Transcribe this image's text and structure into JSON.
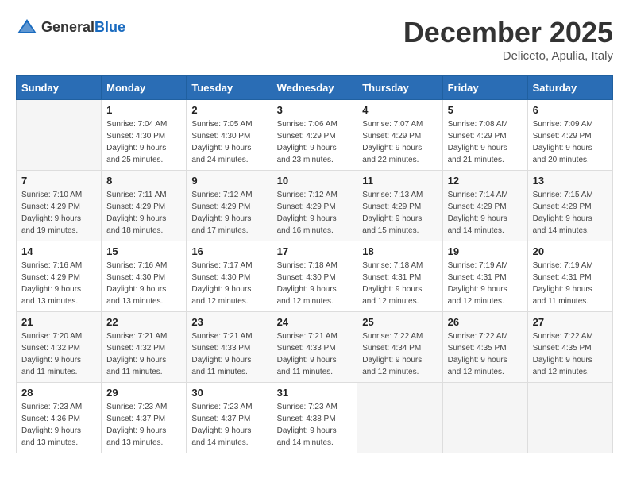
{
  "header": {
    "logo_general": "General",
    "logo_blue": "Blue",
    "month_title": "December 2025",
    "location": "Deliceto, Apulia, Italy"
  },
  "weekdays": [
    "Sunday",
    "Monday",
    "Tuesday",
    "Wednesday",
    "Thursday",
    "Friday",
    "Saturday"
  ],
  "weeks": [
    [
      {
        "day": "",
        "info": ""
      },
      {
        "day": "1",
        "info": "Sunrise: 7:04 AM\nSunset: 4:30 PM\nDaylight: 9 hours\nand 25 minutes."
      },
      {
        "day": "2",
        "info": "Sunrise: 7:05 AM\nSunset: 4:30 PM\nDaylight: 9 hours\nand 24 minutes."
      },
      {
        "day": "3",
        "info": "Sunrise: 7:06 AM\nSunset: 4:29 PM\nDaylight: 9 hours\nand 23 minutes."
      },
      {
        "day": "4",
        "info": "Sunrise: 7:07 AM\nSunset: 4:29 PM\nDaylight: 9 hours\nand 22 minutes."
      },
      {
        "day": "5",
        "info": "Sunrise: 7:08 AM\nSunset: 4:29 PM\nDaylight: 9 hours\nand 21 minutes."
      },
      {
        "day": "6",
        "info": "Sunrise: 7:09 AM\nSunset: 4:29 PM\nDaylight: 9 hours\nand 20 minutes."
      }
    ],
    [
      {
        "day": "7",
        "info": "Sunrise: 7:10 AM\nSunset: 4:29 PM\nDaylight: 9 hours\nand 19 minutes."
      },
      {
        "day": "8",
        "info": "Sunrise: 7:11 AM\nSunset: 4:29 PM\nDaylight: 9 hours\nand 18 minutes."
      },
      {
        "day": "9",
        "info": "Sunrise: 7:12 AM\nSunset: 4:29 PM\nDaylight: 9 hours\nand 17 minutes."
      },
      {
        "day": "10",
        "info": "Sunrise: 7:12 AM\nSunset: 4:29 PM\nDaylight: 9 hours\nand 16 minutes."
      },
      {
        "day": "11",
        "info": "Sunrise: 7:13 AM\nSunset: 4:29 PM\nDaylight: 9 hours\nand 15 minutes."
      },
      {
        "day": "12",
        "info": "Sunrise: 7:14 AM\nSunset: 4:29 PM\nDaylight: 9 hours\nand 14 minutes."
      },
      {
        "day": "13",
        "info": "Sunrise: 7:15 AM\nSunset: 4:29 PM\nDaylight: 9 hours\nand 14 minutes."
      }
    ],
    [
      {
        "day": "14",
        "info": "Sunrise: 7:16 AM\nSunset: 4:29 PM\nDaylight: 9 hours\nand 13 minutes."
      },
      {
        "day": "15",
        "info": "Sunrise: 7:16 AM\nSunset: 4:30 PM\nDaylight: 9 hours\nand 13 minutes."
      },
      {
        "day": "16",
        "info": "Sunrise: 7:17 AM\nSunset: 4:30 PM\nDaylight: 9 hours\nand 12 minutes."
      },
      {
        "day": "17",
        "info": "Sunrise: 7:18 AM\nSunset: 4:30 PM\nDaylight: 9 hours\nand 12 minutes."
      },
      {
        "day": "18",
        "info": "Sunrise: 7:18 AM\nSunset: 4:31 PM\nDaylight: 9 hours\nand 12 minutes."
      },
      {
        "day": "19",
        "info": "Sunrise: 7:19 AM\nSunset: 4:31 PM\nDaylight: 9 hours\nand 12 minutes."
      },
      {
        "day": "20",
        "info": "Sunrise: 7:19 AM\nSunset: 4:31 PM\nDaylight: 9 hours\nand 11 minutes."
      }
    ],
    [
      {
        "day": "21",
        "info": "Sunrise: 7:20 AM\nSunset: 4:32 PM\nDaylight: 9 hours\nand 11 minutes."
      },
      {
        "day": "22",
        "info": "Sunrise: 7:21 AM\nSunset: 4:32 PM\nDaylight: 9 hours\nand 11 minutes."
      },
      {
        "day": "23",
        "info": "Sunrise: 7:21 AM\nSunset: 4:33 PM\nDaylight: 9 hours\nand 11 minutes."
      },
      {
        "day": "24",
        "info": "Sunrise: 7:21 AM\nSunset: 4:33 PM\nDaylight: 9 hours\nand 11 minutes."
      },
      {
        "day": "25",
        "info": "Sunrise: 7:22 AM\nSunset: 4:34 PM\nDaylight: 9 hours\nand 12 minutes."
      },
      {
        "day": "26",
        "info": "Sunrise: 7:22 AM\nSunset: 4:35 PM\nDaylight: 9 hours\nand 12 minutes."
      },
      {
        "day": "27",
        "info": "Sunrise: 7:22 AM\nSunset: 4:35 PM\nDaylight: 9 hours\nand 12 minutes."
      }
    ],
    [
      {
        "day": "28",
        "info": "Sunrise: 7:23 AM\nSunset: 4:36 PM\nDaylight: 9 hours\nand 13 minutes."
      },
      {
        "day": "29",
        "info": "Sunrise: 7:23 AM\nSunset: 4:37 PM\nDaylight: 9 hours\nand 13 minutes."
      },
      {
        "day": "30",
        "info": "Sunrise: 7:23 AM\nSunset: 4:37 PM\nDaylight: 9 hours\nand 14 minutes."
      },
      {
        "day": "31",
        "info": "Sunrise: 7:23 AM\nSunset: 4:38 PM\nDaylight: 9 hours\nand 14 minutes."
      },
      {
        "day": "",
        "info": ""
      },
      {
        "day": "",
        "info": ""
      },
      {
        "day": "",
        "info": ""
      }
    ]
  ]
}
